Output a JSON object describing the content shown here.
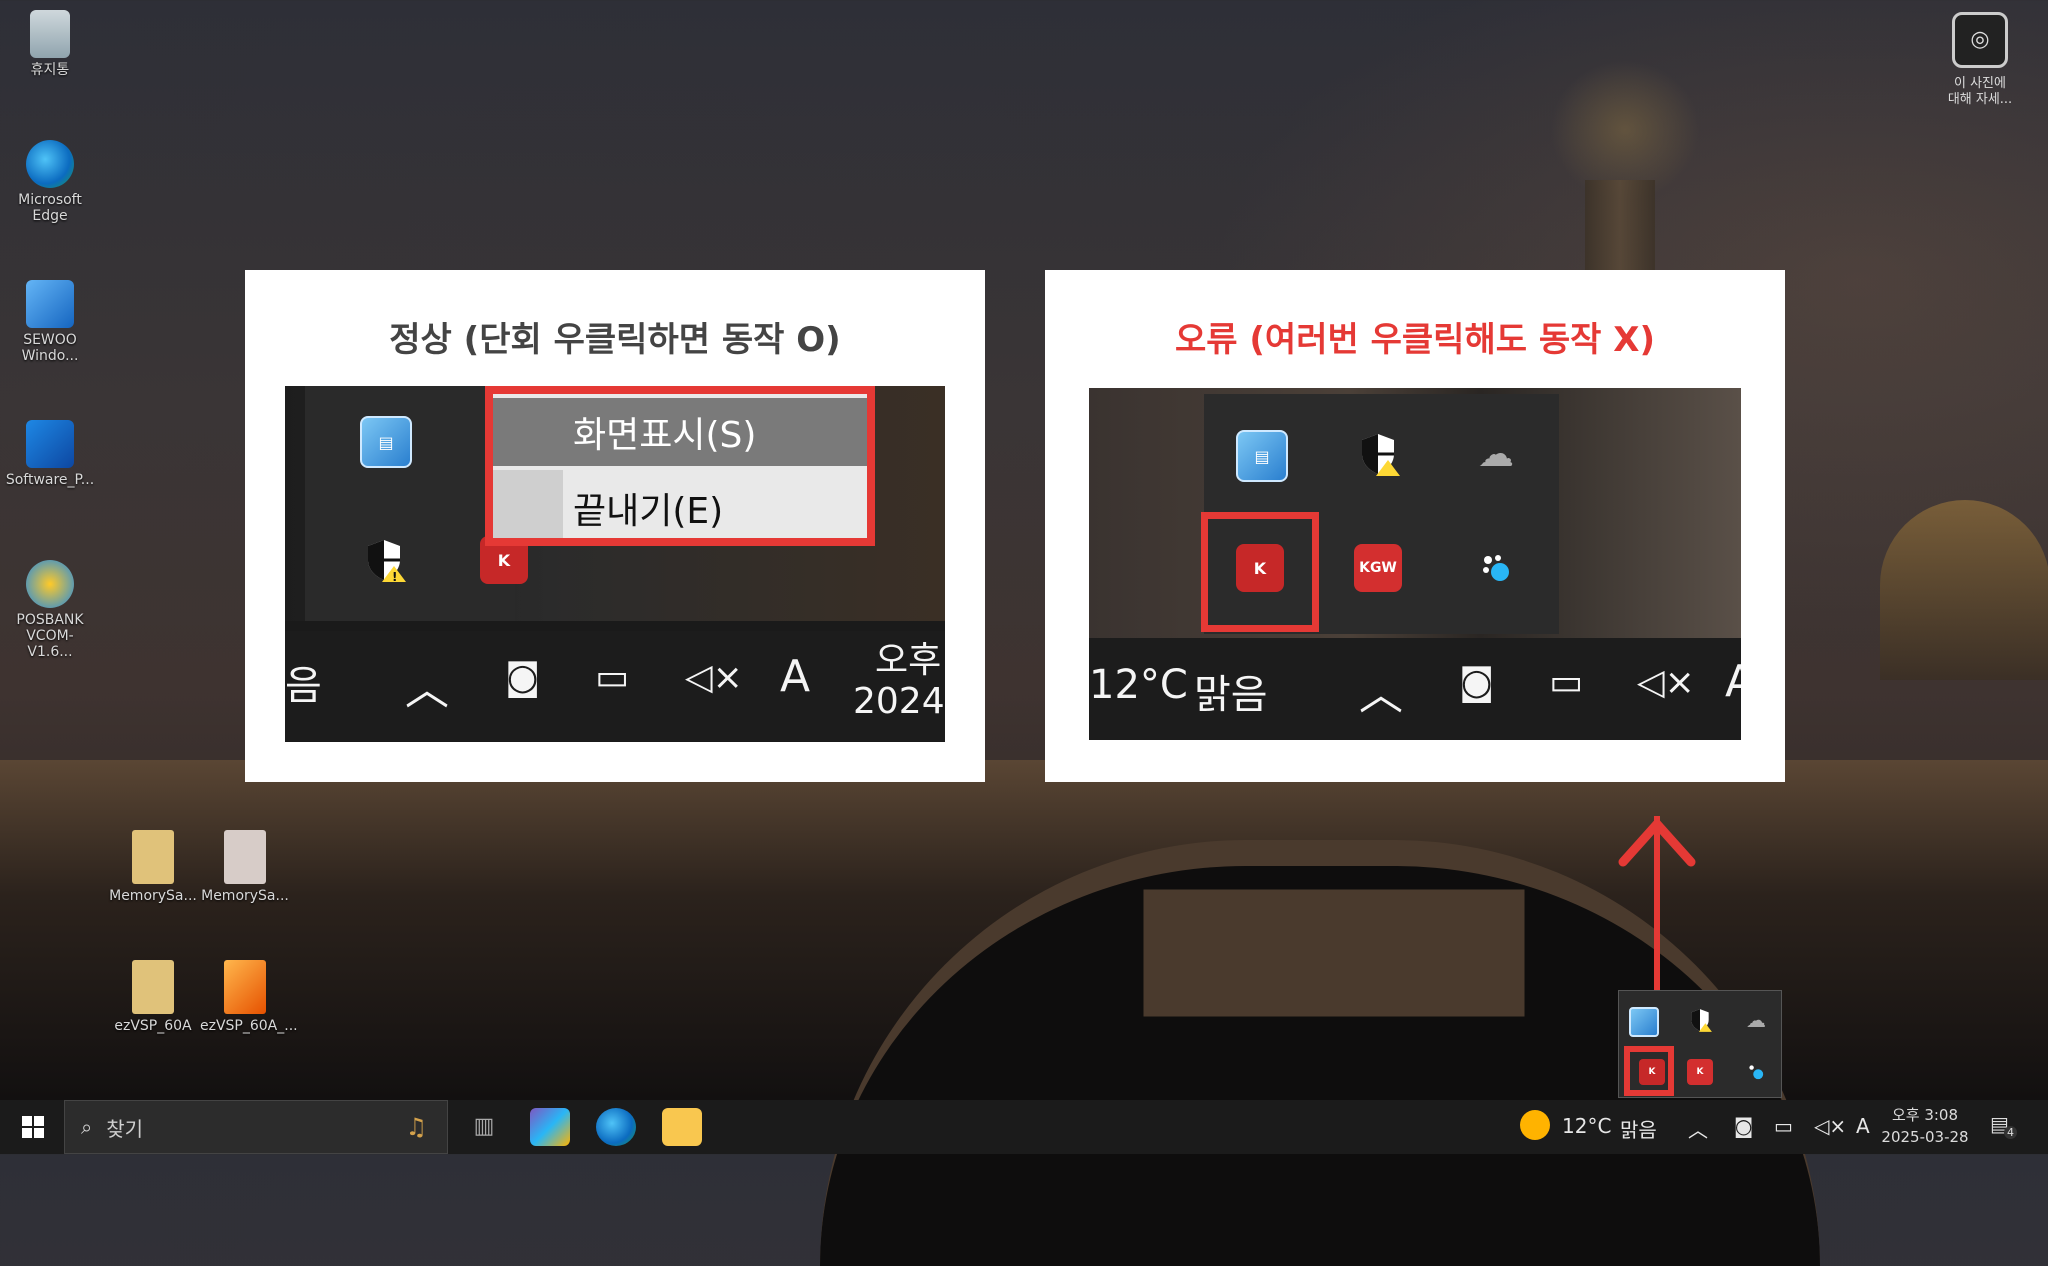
{
  "desktop": {
    "icons": [
      {
        "label": "휴지통",
        "icon": "recycle-bin-icon"
      },
      {
        "label": "Microsoft Edge",
        "icon": "edge-icon"
      },
      {
        "label": "SEWOO Windo...",
        "icon": "sewoo-icon"
      },
      {
        "label": "Software_P...",
        "icon": "software-icon"
      },
      {
        "label": "POSBANK VCOM-V1.6...",
        "icon": "posbank-icon"
      },
      {
        "label": "MemorySa...",
        "icon": "folder-icon"
      },
      {
        "label": "MemorySa...",
        "icon": "file-icon"
      },
      {
        "label": "ezVSP_60A",
        "icon": "folder-icon"
      },
      {
        "label": "ezVSP_60A_...",
        "icon": "vsp-icon"
      }
    ],
    "top_right": {
      "line1": "이 사진에",
      "line2": "대해 자세..."
    }
  },
  "panel_left": {
    "title": "정상 (단회 우클릭하면 동작 O)",
    "title_color": "#444444",
    "menu": {
      "item1": "화면표시(S)",
      "item2": "끝내기(E)"
    },
    "strip": {
      "weather_tail": "음",
      "tray_a": "A",
      "time_top": "오후",
      "date": "2024-"
    }
  },
  "panel_right": {
    "title": "오류 (여러번 우클릭해도 동작 X)",
    "title_color": "#e53935",
    "strip": {
      "temp": "12°C",
      "weather": "맑음",
      "tray_a": "A"
    },
    "icons": {
      "kcc": "K",
      "kgw": "KGW"
    }
  },
  "taskbar": {
    "search_placeholder": "찾기",
    "weather_temp": "12°C",
    "weather_text": "맑음",
    "lang": "A",
    "time": "오후 3:08",
    "date": "2025-03-28",
    "notification_count": "4"
  },
  "colors": {
    "accent_red": "#e53935",
    "tray_bg": "#2b2b2b",
    "panel_bg": "#ffffff"
  }
}
